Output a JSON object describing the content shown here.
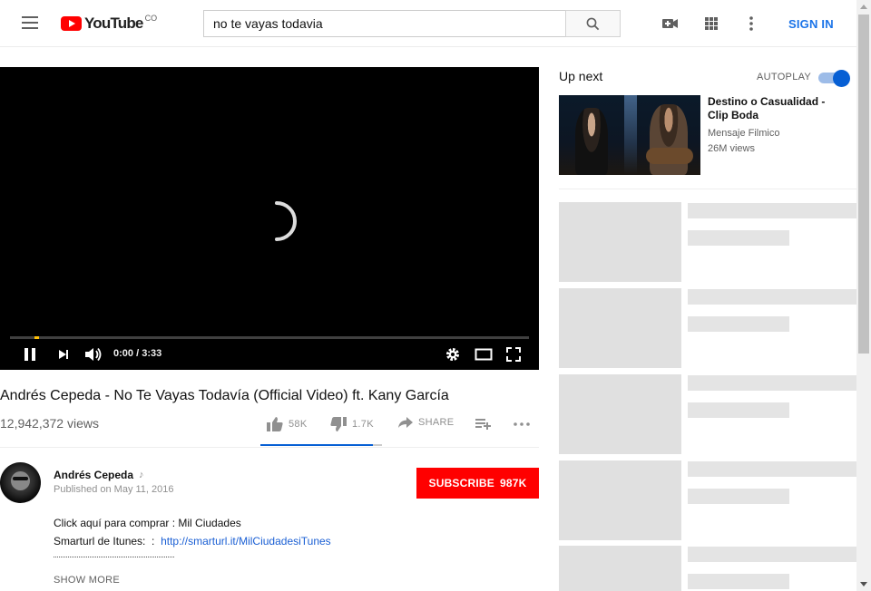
{
  "header": {
    "menu_icon": "hamburger-menu-icon",
    "logo_text": "YouTube",
    "logo_country": "CO",
    "search_value": "no te vayas todavia",
    "search_icon": "search-icon",
    "upload_icon": "video-camera-plus-icon",
    "apps_icon": "apps-grid-icon",
    "more_icon": "more-vertical-icon",
    "sign_in": "SIGN IN"
  },
  "player": {
    "current_time": "0:00",
    "separator": " / ",
    "duration": "3:33",
    "progress_fraction": 0.0,
    "icons": [
      "pause-icon",
      "next-icon",
      "volume-icon",
      "settings-icon",
      "theater-mode-icon",
      "fullscreen-icon"
    ]
  },
  "video": {
    "title": "Andrés Cepeda - No Te Vayas Todavía (Official Video) ft. Kany García",
    "views": "12,942,372 views",
    "likes": "58K",
    "dislikes": "1.7K",
    "share": "SHARE",
    "like_ratio": 0.97
  },
  "channel": {
    "name": "Andrés Cepeda",
    "note_icon": "music-note-icon",
    "published": "Published on May 11, 2016",
    "subscribe_label": "SUBSCRIBE",
    "subscriber_count": "987K"
  },
  "description": {
    "line1": "Click aquí para comprar : Mil Ciudades",
    "line2_prefix": "Smarturl de Itunes:  :  ",
    "line2_link": "http://smarturl.it/MilCiudadesiTunes",
    "show_more": "SHOW MORE"
  },
  "sidebar": {
    "up_next": "Up next",
    "autoplay": "AUTOPLAY",
    "autoplay_on": true,
    "next_video": {
      "title": "Destino o Casualidad - Clip Boda",
      "channel": "Mensaje Filmico",
      "views": "26M views"
    }
  },
  "colors": {
    "brand_red": "#ff0000",
    "link_blue": "#065fd4",
    "sign_in_blue": "#1a73e8",
    "placeholder_gray": "#e0e0e0"
  }
}
